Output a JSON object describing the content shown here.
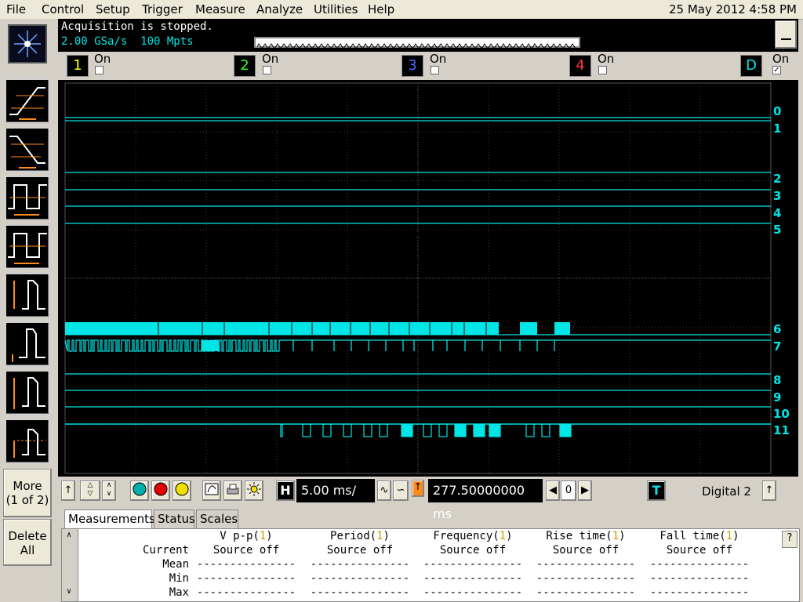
{
  "menu": [
    "File",
    "Control",
    "Setup",
    "Trigger",
    "Measure",
    "Analyze",
    "Utilities",
    "Help"
  ],
  "datetime": "25 May 2012  4:58 PM",
  "status": {
    "acquisition": "Acquisition is stopped.",
    "sample_rate": "2.00 GSa/s",
    "memory": "100 Mpts"
  },
  "channels": [
    {
      "label": "1",
      "on": "On",
      "checked": false,
      "color": "#ffff00"
    },
    {
      "label": "2",
      "on": "On",
      "checked": false,
      "color": "#33ff33"
    },
    {
      "label": "3",
      "on": "On",
      "checked": false,
      "color": "#4466ff"
    },
    {
      "label": "4",
      "on": "On",
      "checked": false,
      "color": "#ff3344"
    },
    {
      "label": "D",
      "on": "On",
      "checked": true,
      "color": "#00e5e5"
    }
  ],
  "digital_labels": [
    "0",
    "1",
    "2",
    "3",
    "4",
    "5",
    "6",
    "7",
    "8",
    "9",
    "10",
    "11"
  ],
  "left_toolbar": {
    "more": "More",
    "more_page": "(1 of 2)",
    "delete": "Delete",
    "delete_all": "All"
  },
  "control": {
    "h_label": "H",
    "timebase": "5.00 ms/",
    "position": "277.50000000 ms",
    "zero": "0",
    "t_label": "T",
    "trigger_source": "Digital 2"
  },
  "tabs": [
    "Measurements",
    "Status",
    "Scales"
  ],
  "measurements": {
    "columns": [
      {
        "name": "V p-p",
        "ch": "1",
        "current": "Source off"
      },
      {
        "name": "Period",
        "ch": "1",
        "current": "Source off"
      },
      {
        "name": "Frequency",
        "ch": "1",
        "current": "Source off"
      },
      {
        "name": "Rise time",
        "ch": "1",
        "current": "Source off"
      },
      {
        "name": "Fall time",
        "ch": "1",
        "current": "Source off"
      }
    ],
    "rows": [
      "Current",
      "Mean",
      "Min",
      "Max"
    ],
    "dash": "---------------",
    "help": "?"
  },
  "colors": {
    "trace": "#00e5e5",
    "grid": "#3c3c3c",
    "accent": "#ff8c1a"
  }
}
